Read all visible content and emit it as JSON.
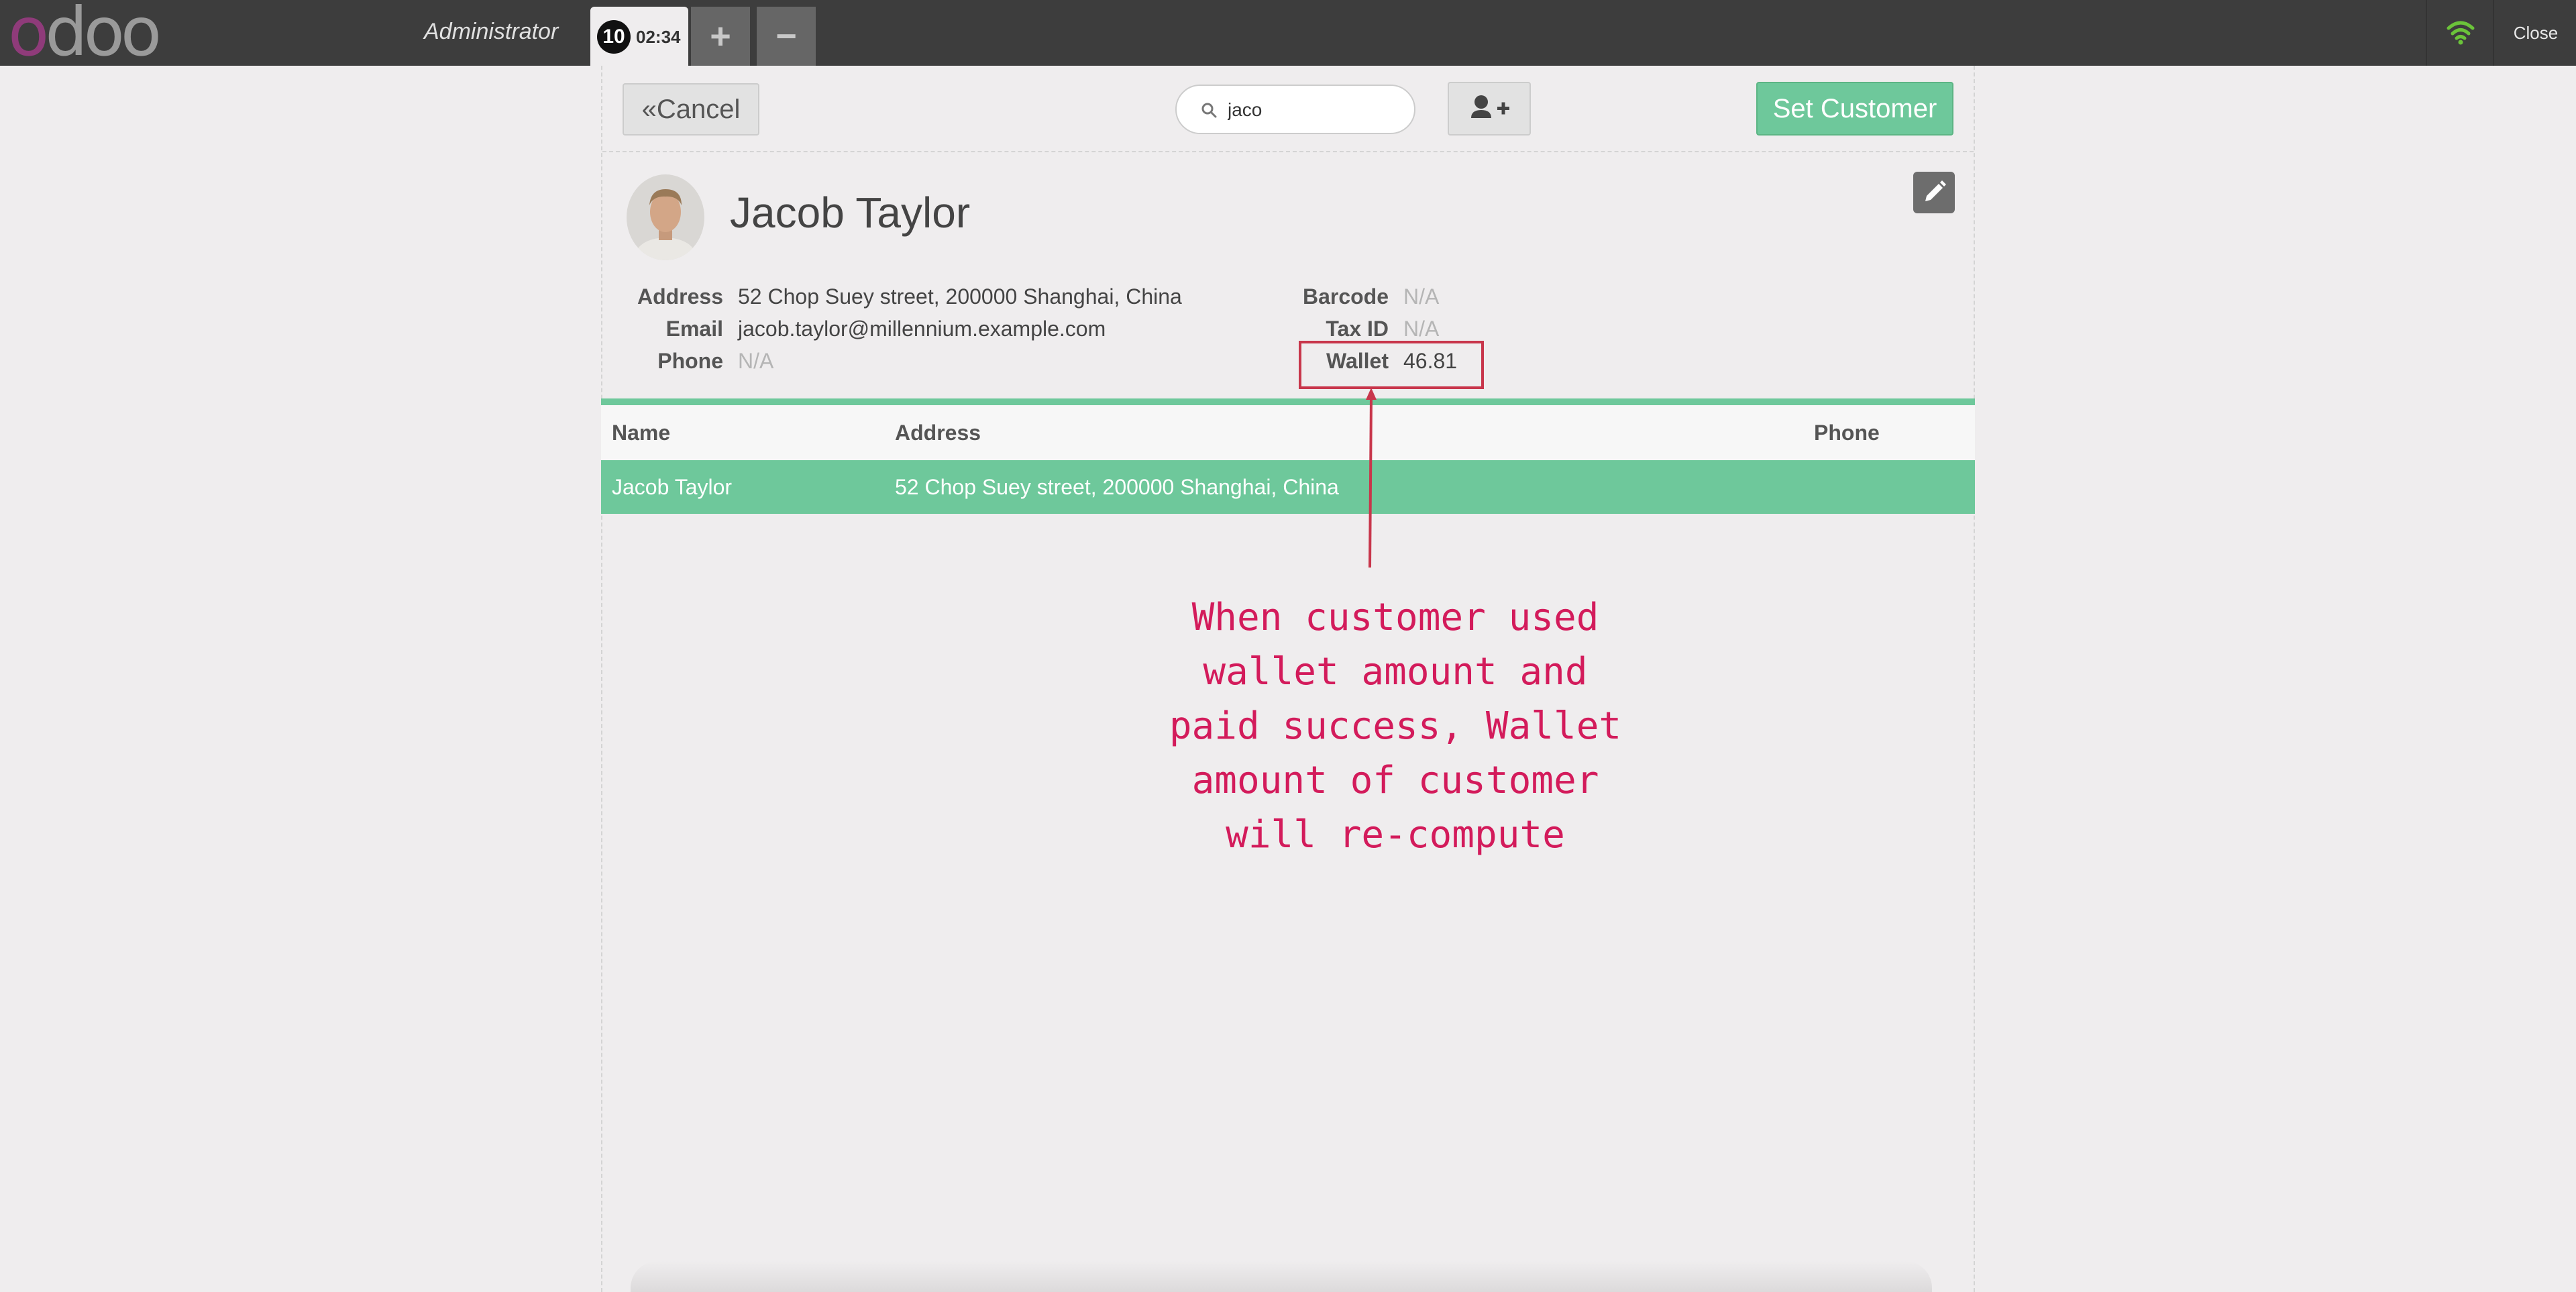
{
  "topbar": {
    "logo": "odoo",
    "user": "Administrator",
    "order_number": "10",
    "order_time": "02:34",
    "add_order": "+",
    "remove_order": "−",
    "close_label": "Close"
  },
  "toolbar": {
    "cancel_label": "Cancel",
    "search_value": "jaco",
    "set_customer_label": "Set Customer"
  },
  "customer": {
    "name": "Jacob Taylor",
    "address_label": "Address",
    "address": "52 Chop Suey street, 200000 Shanghai, China",
    "email_label": "Email",
    "email": "jacob.taylor@millennium.example.com",
    "phone_label": "Phone",
    "phone": "N/A",
    "barcode_label": "Barcode",
    "barcode": "N/A",
    "taxid_label": "Tax ID",
    "taxid": "N/A",
    "wallet_label": "Wallet",
    "wallet": "46.81"
  },
  "table": {
    "columns": [
      "Name",
      "Address",
      "Phone"
    ],
    "rows": [
      {
        "name": "Jacob Taylor",
        "address": "52 Chop Suey street, 200000 Shanghai, China",
        "phone": ""
      }
    ]
  },
  "annotation": {
    "lines": [
      "When customer used",
      "wallet amount and",
      "paid success, Wallet",
      "amount of customer",
      "will re-compute"
    ]
  },
  "colors": {
    "accent": "#6ec89b",
    "annotation": "#d31b5b",
    "highlight_box": "#c8364b",
    "topbar": "#3d3d3d"
  }
}
